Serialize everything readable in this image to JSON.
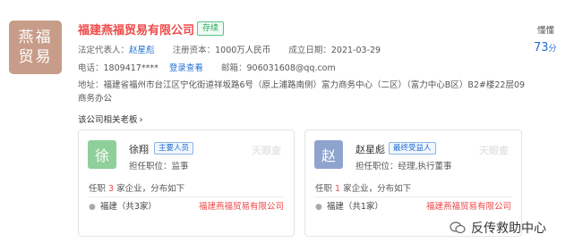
{
  "company": {
    "logo_line1": "燕福",
    "logo_line2": "贸易",
    "name": "福建燕福贸易有限公司",
    "status": "存续",
    "legal_rep_key": "法定代表人：",
    "legal_rep": "赵星彪",
    "capital_key": "注册资本：",
    "capital": "1000万人民币",
    "founded_key": "成立日期：",
    "founded": "2021-03-29",
    "phone_key": "电话：",
    "phone": "1809417****",
    "phone_link": "登录查看",
    "email_key": "邮箱：",
    "email": "906031608@qq.com",
    "address_key": "地址：",
    "address": "福建省福州市台江区宁化街道祥坂路6号（原上浦路南侧）富力商务中心（二区）（富力中心B区）B2#楼22层09商务办公",
    "related_bosses": "该公司相关老板",
    "follow_label": "懂懂",
    "score": "73",
    "score_unit": "分"
  },
  "cards": [
    {
      "avatar": "徐",
      "name": "徐翔",
      "tag": "主要人员",
      "role_key": "担任职位：",
      "role": "监事",
      "watermark": "天眼查",
      "tenure_prefix": "任职",
      "tenure_count": "3",
      "tenure_suffix": "家企业，分布如下",
      "location": "福建（共3家）",
      "company": "福建燕福贸易有限公司"
    },
    {
      "avatar": "赵",
      "name": "赵星彪",
      "tag": "最终受益人",
      "role_key": "担任职位：",
      "role": "经理,执行董事",
      "watermark": "天眼查",
      "tenure_prefix": "任职",
      "tenure_count": "1",
      "tenure_suffix": "家企业，分布如下",
      "location": "福建（共1家）",
      "company": "福建燕福贸易有限公司"
    }
  ],
  "watermark_account": "反传救助中心",
  "icons": [
    "location-pin-icon",
    "chevron-right-icon",
    "wechat-icon"
  ]
}
